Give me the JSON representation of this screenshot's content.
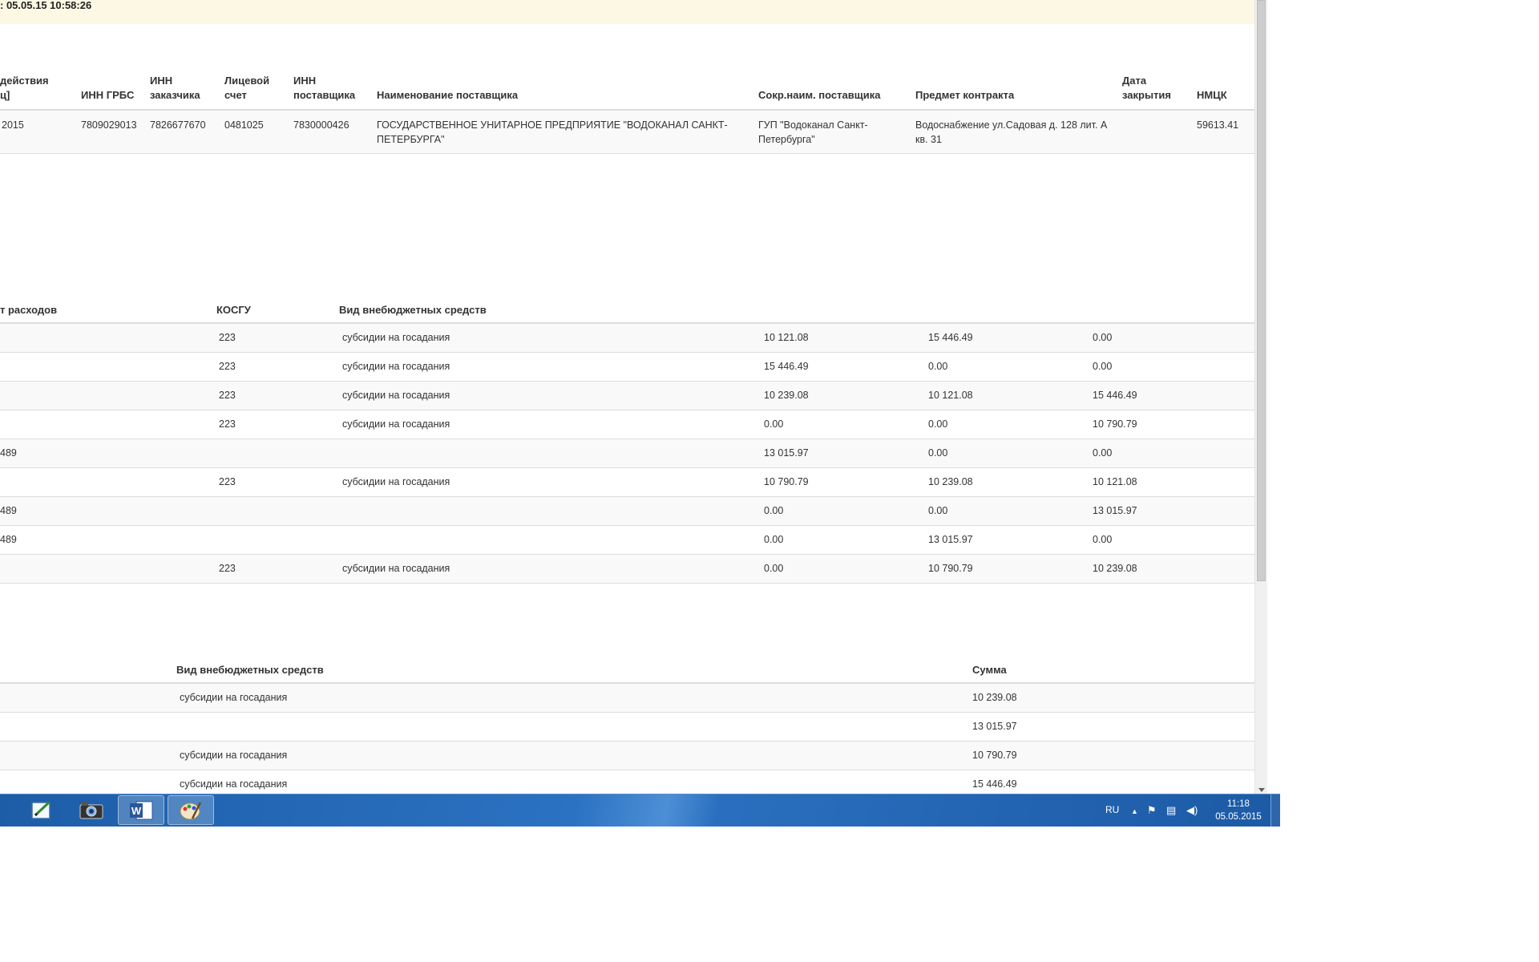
{
  "info_bar": {
    "text": ": 05.05.15 10:58:26"
  },
  "table1": {
    "headers": [
      "действия\nц]",
      "ИНН ГРБС",
      "ИНН\nзаказчика",
      "Лицевой\nсчет",
      "ИНН\nпоставщика",
      "Наименование поставщика",
      "Сокр.наим. поставщика",
      "Предмет контракта",
      "Дата\nзакрытия",
      "НМЦК"
    ],
    "rows": [
      [
        "2015",
        "7809029013",
        "7826677670",
        "0481025",
        "7830000426",
        "ГОСУДАРСТВЕННОЕ УНИТАРНОЕ ПРЕДПРИЯТИЕ \"ВОДОКАНАЛ САНКТ-ПЕТЕРБУРГА\"",
        "ГУП \"Водоканал Санкт-Петербурга\"",
        "Водоснабжение ул.Садовая д. 128 лит. А кв. 31",
        "",
        "59613.41"
      ]
    ]
  },
  "table2": {
    "headers": [
      "т расходов",
      "КОСГУ",
      "Вид внебюджетных средств",
      "",
      "",
      ""
    ],
    "rows": [
      [
        "",
        "223",
        "субсидии на госадания",
        "10 121.08",
        "15 446.49",
        "0.00"
      ],
      [
        "",
        "223",
        "субсидии на госадания",
        "15 446.49",
        "0.00",
        "0.00"
      ],
      [
        "",
        "223",
        "субсидии на госадания",
        "10 239.08",
        "10 121.08",
        "15 446.49"
      ],
      [
        "",
        "223",
        "субсидии на госадания",
        "0.00",
        "0.00",
        "10 790.79"
      ],
      [
        "489",
        "",
        "",
        "13 015.97",
        "0.00",
        "0.00"
      ],
      [
        "",
        "223",
        "субсидии на госадания",
        "10 790.79",
        "10 239.08",
        "10 121.08"
      ],
      [
        "489",
        "",
        "",
        "0.00",
        "0.00",
        "13 015.97"
      ],
      [
        "489",
        "",
        "",
        "0.00",
        "13 015.97",
        "0.00"
      ],
      [
        "",
        "223",
        "субсидии на госадания",
        "0.00",
        "10 790.79",
        "10 239.08"
      ]
    ]
  },
  "table3": {
    "headers": [
      "Вид внебюджетных средств",
      "Сумма"
    ],
    "rows": [
      [
        "субсидии на госадания",
        "10 239.08"
      ],
      [
        "",
        "13 015.97"
      ],
      [
        "субсидии на госадания",
        "10 790.79"
      ],
      [
        "субсидии на госадания",
        "15 446.49"
      ]
    ]
  },
  "taskbar": {
    "apps": [
      {
        "icon": "media-player-icon",
        "glyph": "●"
      },
      {
        "icon": "notepad-icon",
        "glyph": "✎"
      },
      {
        "icon": "camera-app-icon",
        "glyph": "▣"
      },
      {
        "icon": "word-icon",
        "glyph": "W"
      },
      {
        "icon": "paint-icon",
        "glyph": "✿"
      }
    ],
    "language": "RU",
    "tray_icons": [
      "show-hidden-icon",
      "action-center-flag-icon",
      "network-icon",
      "volume-icon"
    ],
    "clock_time": "11:18",
    "clock_date": "05.05.2015"
  }
}
